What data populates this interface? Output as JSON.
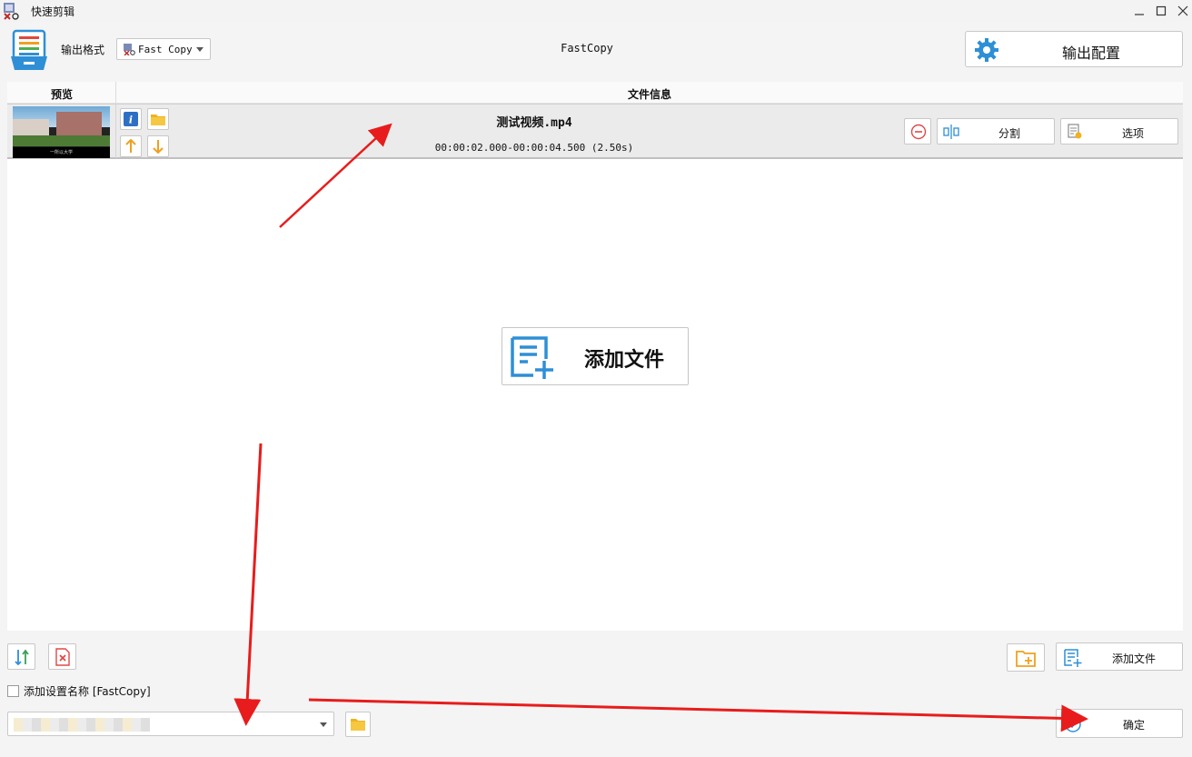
{
  "window": {
    "title": "快速剪辑",
    "controls": [
      "minimize-icon",
      "maximize-icon",
      "close-icon"
    ]
  },
  "toolbar": {
    "format_label": "输出格式",
    "format_value": "Fast Copy",
    "center_title": "FastCopy",
    "config_button": "输出配置"
  },
  "table": {
    "headers": {
      "preview": "预览",
      "file_info": "文件信息"
    },
    "rows": [
      {
        "filename": "测试视频.mp4",
        "time_range": "00:00:02.000-00:00:04.500 (2.50s)",
        "thumbnail_caption": "一所以大学",
        "split_label": "分割",
        "options_label": "选项"
      }
    ],
    "add_file_label": "添加文件"
  },
  "bottom": {
    "add_file_label": "添加文件",
    "checkbox_label": "添加设置名称 [FastCopy]",
    "checkbox_checked": false,
    "ok_label": "确定"
  },
  "colors": {
    "accent_blue": "#2e8fd6",
    "orange": "#f0a020",
    "red": "#e04848",
    "annotation_red": "#e81c1c"
  }
}
